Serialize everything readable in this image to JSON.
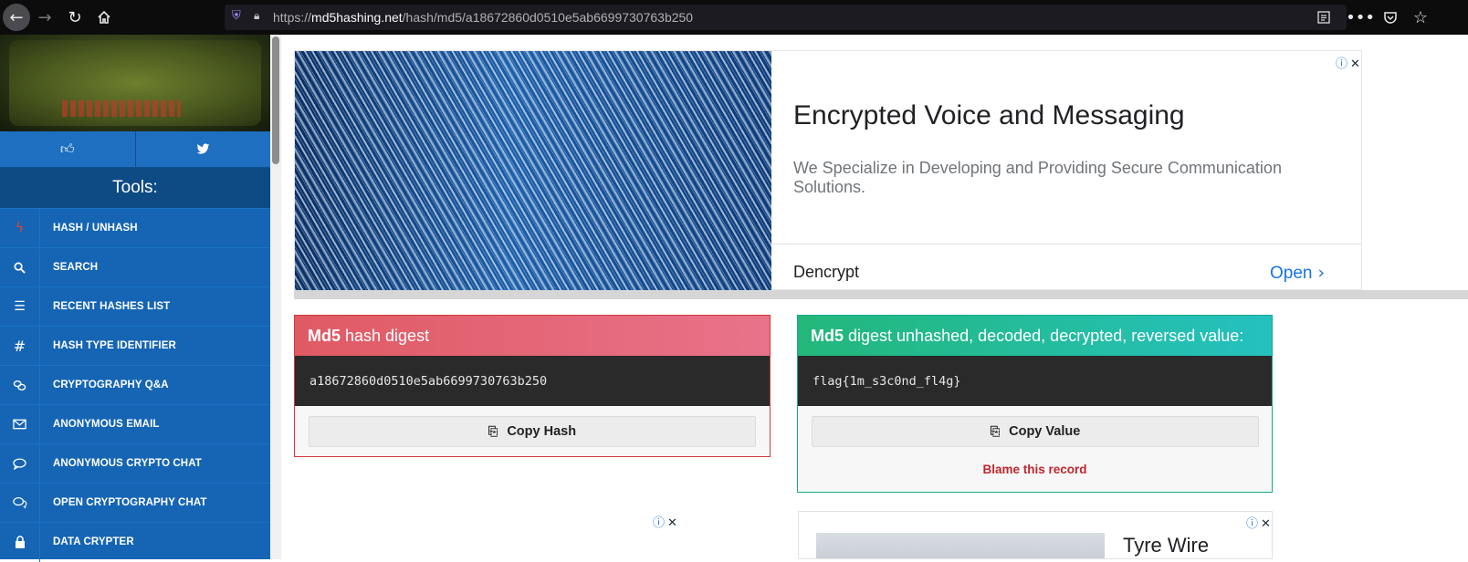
{
  "browser": {
    "url_host": "md5hashing.net",
    "url_prefix": "https://",
    "url_path": "/hash/md5/a18672860d0510e5ab6699730763b250",
    "icons": {
      "back": "arrow-left-icon",
      "forward": "arrow-right-icon",
      "reload": "reload-icon",
      "home": "home-icon",
      "shield": "shield-icon",
      "lock": "lock-icon",
      "reader": "reader-view-icon",
      "more": "more-icon",
      "pocket": "pocket-icon",
      "bookmark": "star-icon"
    }
  },
  "sidebar": {
    "tools_title": "Tools:",
    "social": [
      {
        "icon": "thumbs-up-icon"
      },
      {
        "icon": "twitter-icon"
      }
    ],
    "items": [
      {
        "label": "HASH / UNHASH",
        "icon": "bolt-icon"
      },
      {
        "label": "SEARCH",
        "icon": "search-icon"
      },
      {
        "label": "RECENT HASHES LIST",
        "icon": "list-icon"
      },
      {
        "label": "HASH TYPE IDENTIFIER",
        "icon": "hash-icon"
      },
      {
        "label": "CRYPTOGRAPHY Q&A",
        "icon": "link-icon"
      },
      {
        "label": "ANONYMOUS EMAIL",
        "icon": "envelope-icon"
      },
      {
        "label": "ANONYMOUS CRYPTO CHAT",
        "icon": "chat-bubble-icon"
      },
      {
        "label": "OPEN CRYPTOGRAPHY CHAT",
        "icon": "chat-bubbles-icon"
      },
      {
        "label": "DATA CRYPTER",
        "icon": "lock-icon"
      }
    ]
  },
  "ad_top": {
    "title": "Encrypted Voice and Messaging",
    "description": "We Specialize in Developing and Providing Secure Communication Solutions.",
    "brand": "Dencrypt",
    "cta": "Open",
    "close_icons": [
      "adchoices-icon",
      "close-icon"
    ]
  },
  "hash_card": {
    "title_strong": "Md5",
    "title_rest": "hash digest",
    "value": "a18672860d0510e5ab6699730763b250",
    "button": "Copy Hash",
    "accent": "#e05a64"
  },
  "value_card": {
    "title_strong": "Md5",
    "title_rest": "digest unhashed, decoded, decrypted, reversed value:",
    "value": "flag{1m_s3c0nd_fl4g}",
    "button": "Copy Value",
    "blame": "Blame this record",
    "accent": "#23b77a"
  },
  "ad_bottom_right": {
    "title": "Tyre Wire"
  },
  "colors": {
    "sidebar": "#1565b4",
    "sidebar_header": "#0e4b85",
    "ad_link": "#1a73e8"
  }
}
